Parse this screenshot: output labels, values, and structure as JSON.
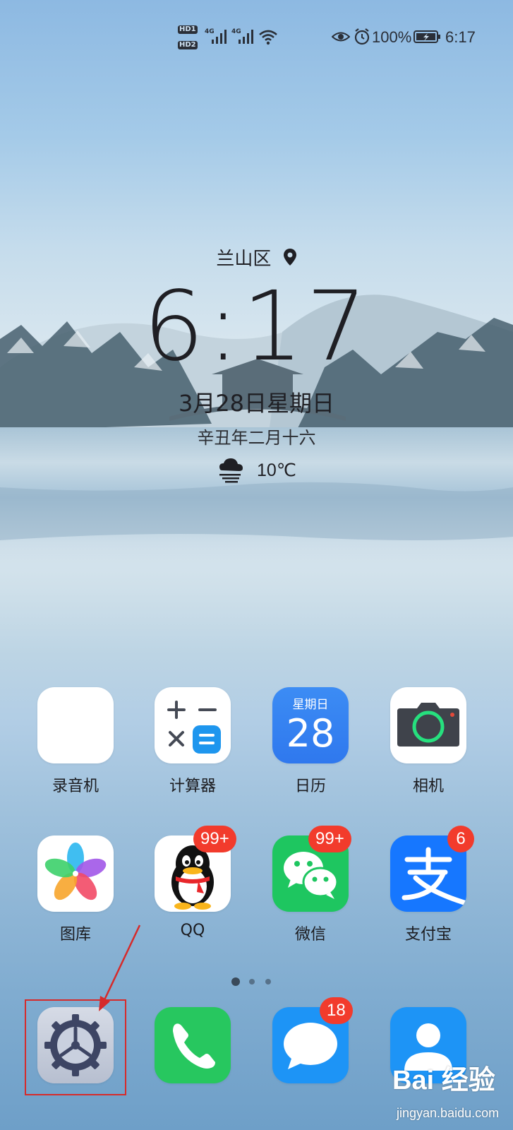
{
  "status_bar": {
    "hd1": "HD1",
    "hd2": "HD2",
    "net1": "4G",
    "net2": "4G",
    "battery_percent": "100%",
    "time": "6:17"
  },
  "lock_widget": {
    "location": "兰山区",
    "time": "6:17",
    "date": "3月28日星期日",
    "lunar_date": "辛丑年二月十六",
    "temperature": "10℃"
  },
  "apps_row1": [
    {
      "label": "录音机",
      "icon": "recorder-icon"
    },
    {
      "label": "计算器",
      "icon": "calculator-icon"
    },
    {
      "label": "日历",
      "icon": "calendar-icon",
      "icon_weekday": "星期日",
      "icon_day": "28"
    },
    {
      "label": "相机",
      "icon": "camera-icon"
    }
  ],
  "apps_row2": [
    {
      "label": "图库",
      "icon": "gallery-icon"
    },
    {
      "label": "QQ",
      "icon": "qq-icon",
      "badge": "99+"
    },
    {
      "label": "微信",
      "icon": "wechat-icon",
      "badge": "99+"
    },
    {
      "label": "支付宝",
      "icon": "alipay-icon",
      "badge": "6"
    }
  ],
  "dock": [
    {
      "icon": "settings-icon"
    },
    {
      "icon": "phone-icon"
    },
    {
      "icon": "messages-icon",
      "badge": "18"
    },
    {
      "icon": "contacts-icon"
    }
  ],
  "page_indicator": {
    "pages": 3,
    "current": 1
  },
  "watermark": {
    "brand": "Bai 经验",
    "url": "jingyan.baidu.com"
  },
  "colors": {
    "badge": "#f23b2c",
    "highlight": "#d62a2a"
  }
}
